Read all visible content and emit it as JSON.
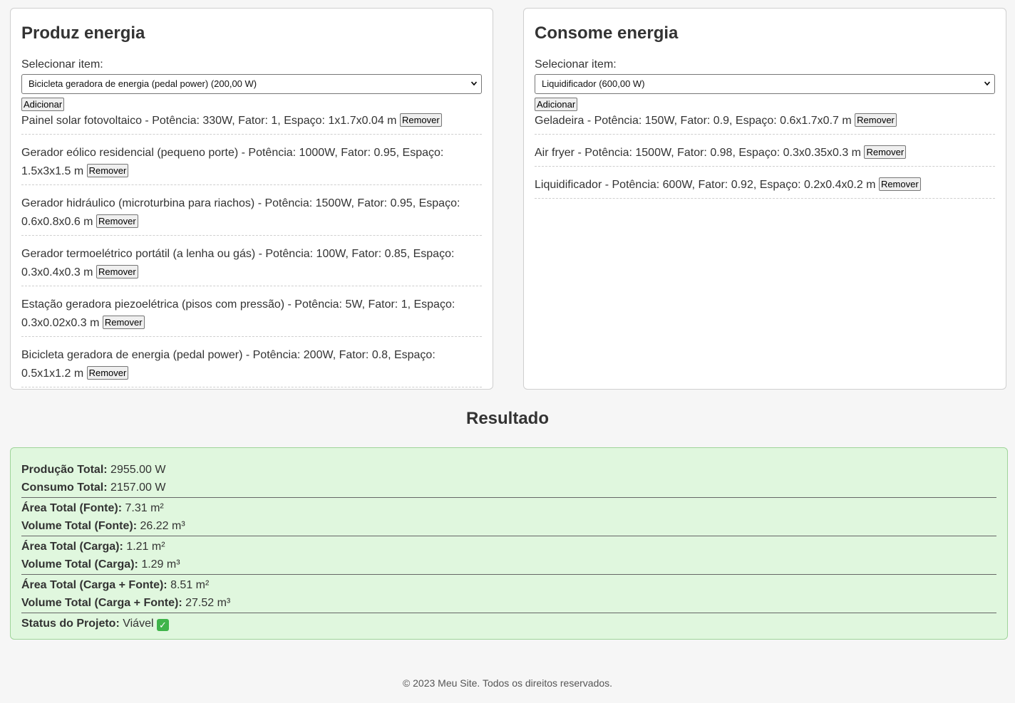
{
  "produz": {
    "title": "Produz energia",
    "select_label": "Selecionar item:",
    "selected_option": "Bicicleta geradora de energia (pedal power) (200,00 W)",
    "add_label": "Adicionar",
    "remove_label": "Remover",
    "items": [
      "Painel solar fotovoltaico - Potência: 330W, Fator: 1, Espaço: 1x1.7x0.04 m",
      "Gerador eólico residencial (pequeno porte) - Potência: 1000W, Fator: 0.95, Espaço: 1.5x3x1.5 m",
      "Gerador hidráulico (microturbina para riachos) - Potência: 1500W, Fator: 0.95, Espaço: 0.6x0.8x0.6 m",
      "Gerador termoelétrico portátil (a lenha ou gás) - Potência: 100W, Fator: 0.85, Espaço: 0.3x0.4x0.3 m",
      "Estação geradora piezoelétrica (pisos com pressão) - Potência: 5W, Fator: 1, Espaço: 0.3x0.02x0.3 m",
      "Bicicleta geradora de energia (pedal power) - Potência: 200W, Fator: 0.8, Espaço: 0.5x1x1.2 m"
    ]
  },
  "consome": {
    "title": "Consome energia",
    "select_label": "Selecionar item:",
    "selected_option": "Liquidificador (600,00 W)",
    "add_label": "Adicionar",
    "remove_label": "Remover",
    "items": [
      "Geladeira - Potência: 150W, Fator: 0.9, Espaço: 0.6x1.7x0.7 m",
      "Air fryer - Potência: 1500W, Fator: 0.98, Espaço: 0.3x0.35x0.3 m",
      "Liquidificador - Potência: 600W, Fator: 0.92, Espaço: 0.2x0.4x0.2 m"
    ]
  },
  "resultado": {
    "title": "Resultado",
    "producao_label": "Produção Total:",
    "producao_value": "2955.00 W",
    "consumo_label": "Consumo Total:",
    "consumo_value": "2157.00 W",
    "area_fonte_label": "Área Total (Fonte):",
    "area_fonte_value": "7.31 m²",
    "volume_fonte_label": "Volume Total (Fonte):",
    "volume_fonte_value": "26.22 m³",
    "area_carga_label": "Área Total (Carga):",
    "area_carga_value": "1.21 m²",
    "volume_carga_label": "Volume Total (Carga):",
    "volume_carga_value": "1.29 m³",
    "area_total_label": "Área Total (Carga + Fonte):",
    "area_total_value": "8.51 m²",
    "volume_total_label": "Volume Total (Carga + Fonte):",
    "volume_total_value": "27.52 m³",
    "status_label": "Status do Projeto:",
    "status_value": "Viável",
    "status_icon": "check-mark-icon",
    "status_icon_glyph": "✓",
    "status_icon_color": "#3fb44a"
  },
  "footer": {
    "text": "© 2023 Meu Site. Todos os direitos reservados."
  },
  "colors": {
    "background": "#f6f6f6",
    "result_bg": "#e0f7de",
    "result_border": "#9fd49a"
  }
}
